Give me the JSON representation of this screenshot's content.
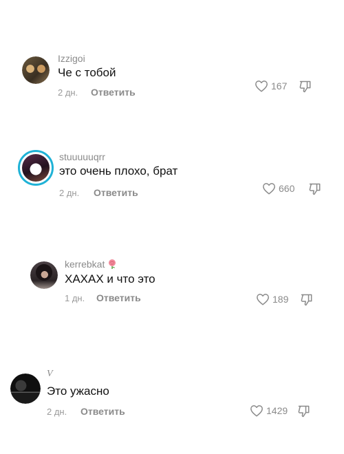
{
  "comments": [
    {
      "username": "Izzigoi",
      "text": "Че с тобой",
      "time": "2 дн.",
      "reply": "Ответить",
      "likes": "167"
    },
    {
      "username": "stuuuuuqrr",
      "text": "это очень плохо, брат",
      "time": "2 дн.",
      "reply": "Ответить",
      "likes": "660"
    },
    {
      "username": "kerrebkat",
      "text": "ХАХАХ и что это",
      "time": "1 дн.",
      "reply": "Ответить",
      "likes": "189"
    },
    {
      "username": "V",
      "text": "Это ужасно",
      "time": "2 дн.",
      "reply": "Ответить",
      "likes": "1429"
    }
  ],
  "icons": {
    "like": "heart-outline-icon",
    "dislike": "thumbs-down-outline-icon",
    "badge": "rose-emoji-icon"
  },
  "colors": {
    "story_ring": "#1fb2d6",
    "text": "#111111",
    "secondary": "#8a8a8a"
  }
}
